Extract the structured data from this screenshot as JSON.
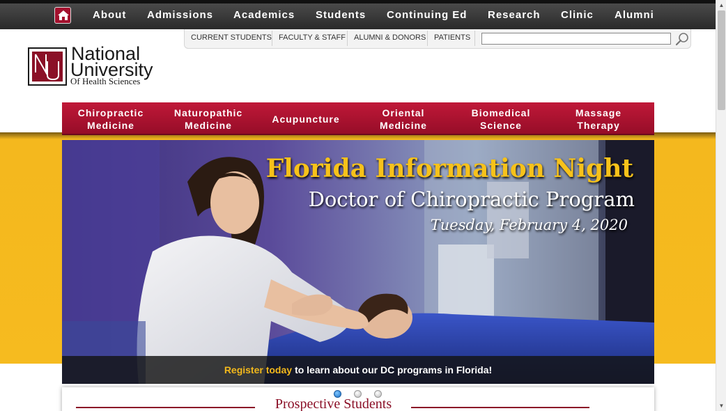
{
  "topnav": {
    "home_icon": "home-icon",
    "items": [
      "About",
      "Admissions",
      "Academics",
      "Students",
      "Continuing Ed",
      "Research",
      "Clinic",
      "Alumni"
    ]
  },
  "utility": {
    "links": [
      "CURRENT STUDENTS",
      "FACULTY & STAFF",
      "ALUMNI & DONORS",
      "PATIENTS"
    ],
    "search_value": "",
    "search_icon": "magnifier-icon"
  },
  "logo": {
    "line1": "National",
    "line2": "University",
    "line3": "Of Health Sciences",
    "monogram": "NU"
  },
  "programs": [
    {
      "line1": "Chiropractic",
      "line2": "Medicine"
    },
    {
      "line1": "Naturopathic",
      "line2": "Medicine"
    },
    {
      "line1": "Acupuncture",
      "line2": ""
    },
    {
      "line1": "Oriental",
      "line2": "Medicine"
    },
    {
      "line1": "Biomedical",
      "line2": "Science"
    },
    {
      "line1": "Massage",
      "line2": "Therapy"
    }
  ],
  "hero": {
    "title": "Florida Information Night",
    "subtitle": "Doctor of Chiropractic Program",
    "date": "Tuesday, February 4, 2020",
    "caption_link": "Register today",
    "caption_text": "to learn about our DC programs in Florida!",
    "active_slide": 1,
    "slide_count": 3
  },
  "section": {
    "title": "Prospective Students"
  },
  "colors": {
    "brand_red": "#8b1027",
    "gold": "#f6bb1f",
    "topbar": "#2a2a2a",
    "accent_blue": "#1a6fc4"
  }
}
